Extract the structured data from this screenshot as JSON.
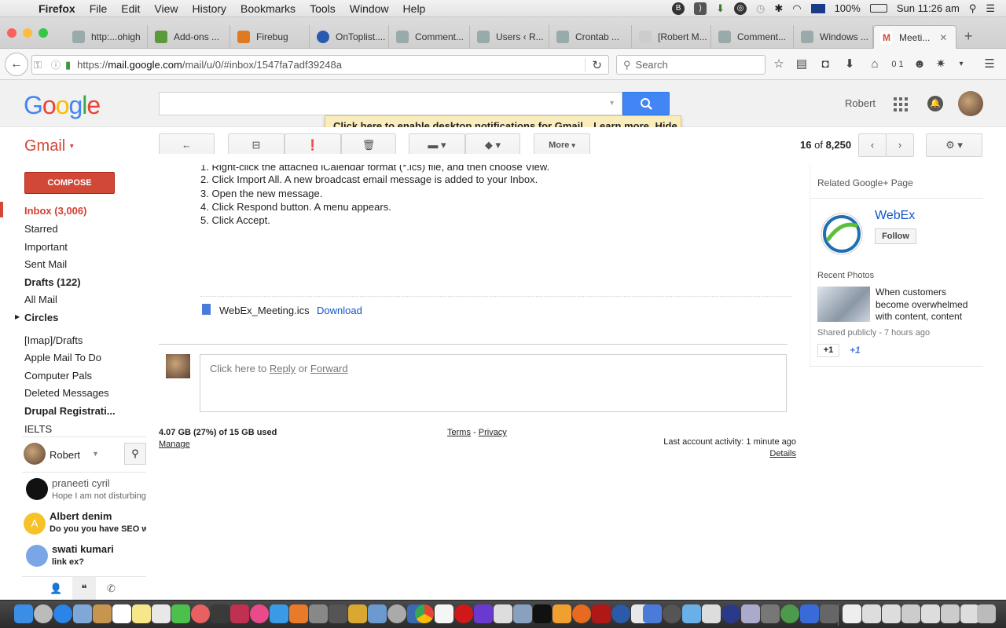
{
  "menubar": {
    "app": "Firefox",
    "items": [
      "File",
      "Edit",
      "View",
      "History",
      "Bookmarks",
      "Tools",
      "Window",
      "Help"
    ],
    "battery": "100%",
    "clock": "Sun 11:26 am"
  },
  "tabs": [
    {
      "label": "http:...ohigh"
    },
    {
      "label": "Add-ons ..."
    },
    {
      "label": "Firebug"
    },
    {
      "label": "OnToplist...."
    },
    {
      "label": "Comment..."
    },
    {
      "label": "Users ‹ R..."
    },
    {
      "label": "Crontab ..."
    },
    {
      "label": "[Robert M..."
    },
    {
      "label": "Comment..."
    },
    {
      "label": "Windows ..."
    },
    {
      "label": "Meeti..."
    }
  ],
  "navbar": {
    "url": "https://mail.google.com/mail/u/0/#inbox/1547fa7adf39248a",
    "url_host": "mail.google.com",
    "url_prefix": "https://",
    "url_path": "/mail/u/0/#inbox/1547fa7adf39248a",
    "search_placeholder": "Search",
    "counter": "0 1"
  },
  "gmail_header": {
    "logo": "Google",
    "user_name": "Robert"
  },
  "notification": {
    "enable_link": "Click here to enable",
    "text": " desktop notifications for Gmail.",
    "learn_more": "Learn more",
    "hide": "Hide"
  },
  "toolbar": {
    "gmail_label": "Gmail",
    "more_label": "More",
    "page_current": "16",
    "page_of": "of",
    "page_total": "8,250"
  },
  "sidebar": {
    "compose": "COMPOSE",
    "items": [
      {
        "label": "Inbox (3,006)"
      },
      {
        "label": "Starred"
      },
      {
        "label": "Important"
      },
      {
        "label": "Sent Mail"
      },
      {
        "label": "Drafts (122)"
      },
      {
        "label": "All Mail"
      },
      {
        "label": "Circles"
      },
      {
        "label": "[Imap]/Drafts"
      },
      {
        "label": "Apple Mail To Do"
      },
      {
        "label": "Computer Pals"
      },
      {
        "label": "Deleted Messages"
      },
      {
        "label": "Drupal Registrati..."
      },
      {
        "label": "IELTS"
      }
    ],
    "chat_user": "Robert",
    "contacts": [
      {
        "name": "praneeti cyril",
        "message": "Hope I am not disturbing"
      },
      {
        "name": "Albert denim",
        "message": "Do you you have SEO w"
      },
      {
        "name": "swati kumari",
        "message": "link ex?"
      }
    ]
  },
  "message": {
    "steps": [
      "1. Right-click the attached iCalendar format (*.ics) file, and then choose View.",
      "2. Click Import All. A new broadcast email message is added to your Inbox.",
      "3. Open the new message.",
      "4. Click Respond button. A menu appears.",
      "5. Click Accept."
    ],
    "attachment_name": "WebEx_Meeting.ics",
    "attachment_download": "Download",
    "reply_prefix": "Click here to ",
    "reply_link": "Reply",
    "reply_or": " or ",
    "forward_link": "Forward"
  },
  "footer": {
    "storage": "4.07 GB (27%) of 15 GB used",
    "manage": "Manage",
    "terms": "Terms",
    "dash": "-",
    "privacy": "Privacy",
    "activity": "Last account activity: 1 minute ago",
    "details": "Details"
  },
  "right_panel": {
    "related_heading": "Related Google+ Page",
    "page_name": "WebEx",
    "follow": "Follow",
    "recent_photos": "Recent Photos",
    "post_text": "When customers become overwhelmed with content, content",
    "shared": "Shared publicly - 7 hours ago",
    "plus_one_button": "+1",
    "plus_one": "+1"
  },
  "colors": {
    "gmail_red": "#d14836",
    "compose_red": "#d14836",
    "link_blue": "#1155cc",
    "search_blue": "#4285f4",
    "notification_bg": "#f9edbe"
  }
}
